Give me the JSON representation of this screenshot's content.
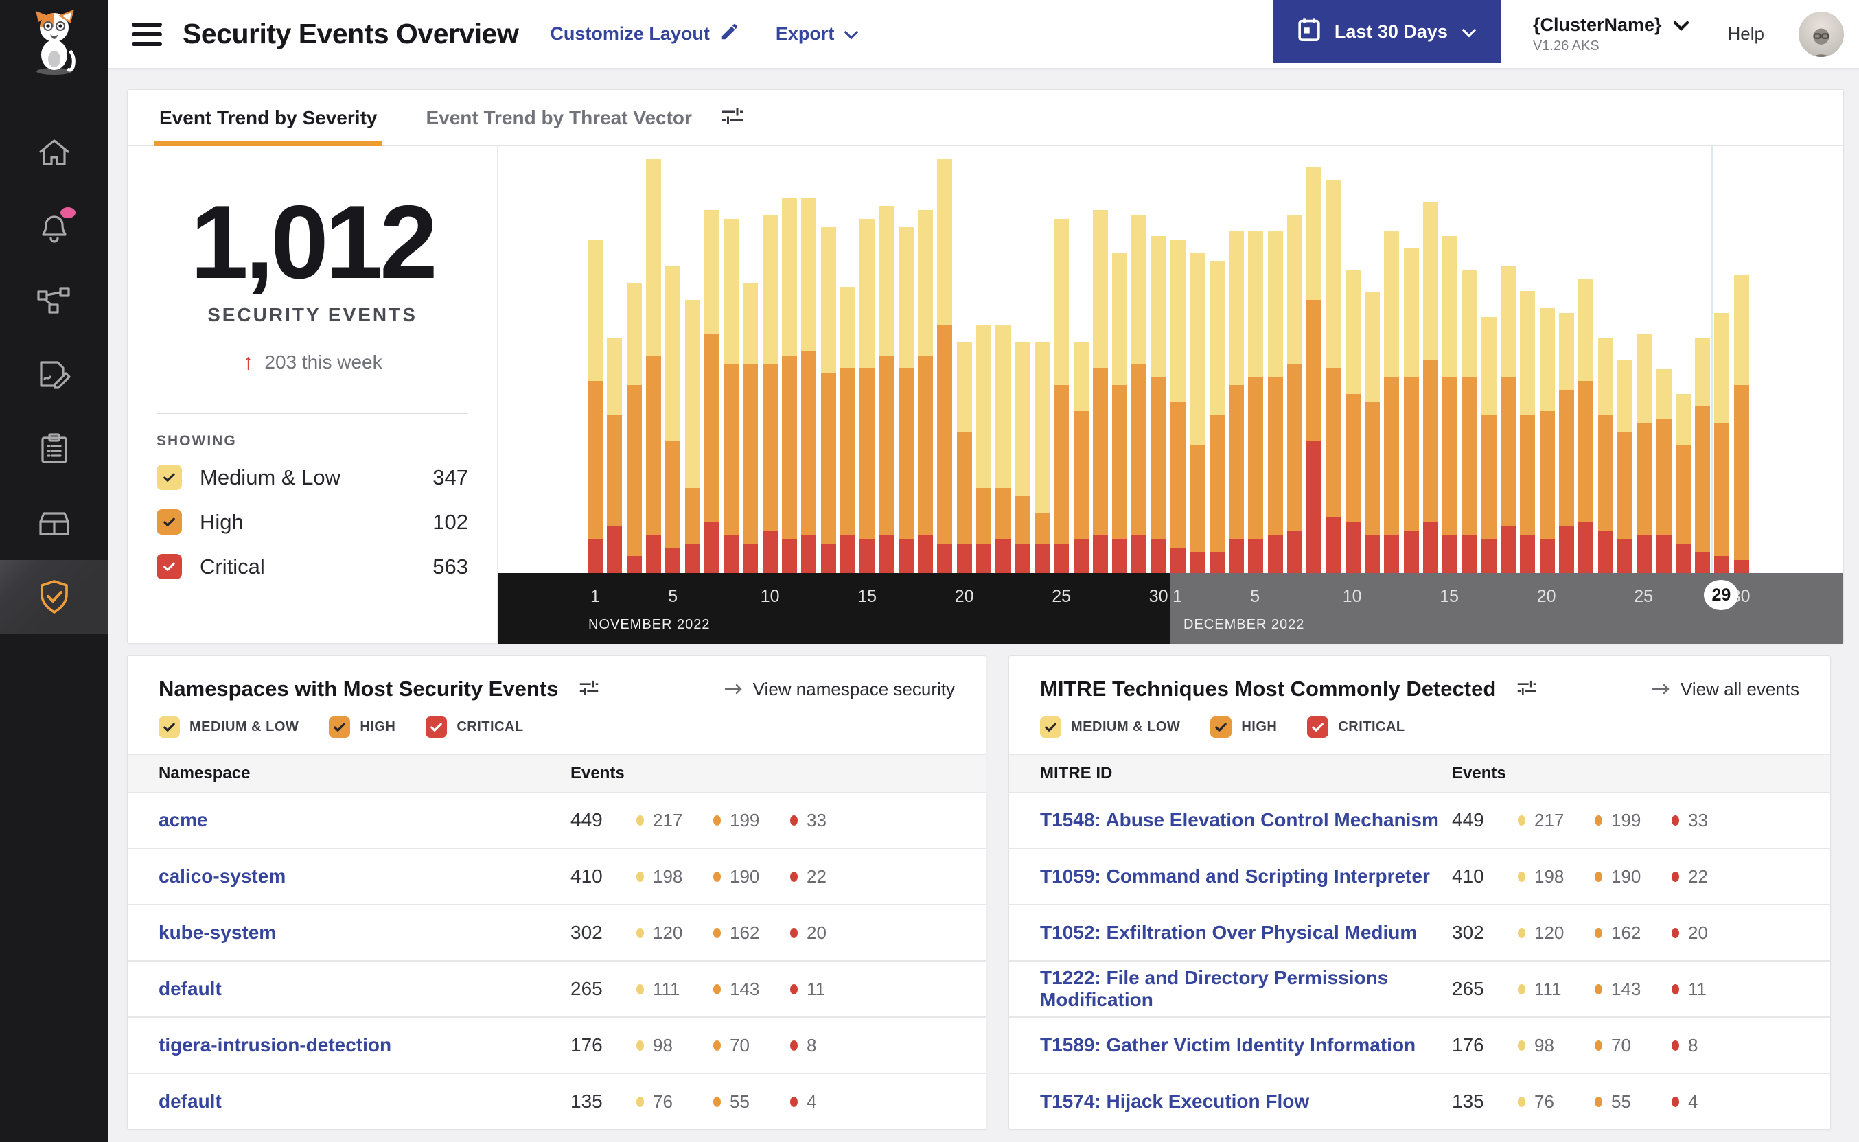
{
  "header": {
    "title": "Security Events Overview",
    "customize_layout_label": "Customize Layout",
    "export_label": "Export",
    "date_range_label": "Last 30 Days",
    "cluster_name": "{ClusterName}",
    "cluster_version": "V1.26 AKS",
    "help_label": "Help"
  },
  "sidebar": {
    "items": [
      {
        "icon": "home-icon",
        "active": false,
        "notification": false
      },
      {
        "icon": "bell-icon",
        "active": false,
        "notification": true
      },
      {
        "icon": "service-graph-icon",
        "active": false,
        "notification": false
      },
      {
        "icon": "policy-edit-icon",
        "active": false,
        "notification": false
      },
      {
        "icon": "clipboard-list-icon",
        "active": false,
        "notification": false
      },
      {
        "icon": "storage-box-icon",
        "active": false,
        "notification": false
      },
      {
        "icon": "shield-check-icon",
        "active": true,
        "notification": false
      }
    ]
  },
  "tabs": {
    "severity": "Event Trend by Severity",
    "threat_vector": "Event Trend by Threat Vector"
  },
  "summary": {
    "total": "1,012",
    "total_label": "SECURITY EVENTS",
    "delta_text": "203 this week",
    "showing_label": "SHOWING",
    "legend": [
      {
        "label": "Medium & Low",
        "count": "347",
        "color": "#f5d97e",
        "check_color": "#26262c"
      },
      {
        "label": "High",
        "count": "102",
        "color": "#e8993b",
        "check_color": "#26262c"
      },
      {
        "label": "Critical",
        "count": "563",
        "color": "#d5453c",
        "check_color": "#ffffff"
      }
    ]
  },
  "severity_filters": [
    {
      "label": "MEDIUM & LOW",
      "color": "#f5d97e",
      "check_color": "#26262c"
    },
    {
      "label": "HIGH",
      "color": "#e8993b",
      "check_color": "#26262c"
    },
    {
      "label": "CRITICAL",
      "color": "#d5453c",
      "check_color": "#ffffff"
    }
  ],
  "chart_data": {
    "type": "bar",
    "subtype": "stacked_daily_events",
    "title": "Event Trend by Severity",
    "stack_order_bottom_to_top": [
      "critical",
      "high",
      "medium_low"
    ],
    "units": "percent_of_plot_height",
    "colors": {
      "medium_low": "#f6dd88",
      "high": "#ea9b41",
      "critical": "#d4453b"
    },
    "highlighted_day": {
      "month": "DECEMBER 2022",
      "day": 29
    },
    "months": [
      {
        "label": "NOVEMBER 2022",
        "ticks": [
          1,
          5,
          10,
          15,
          20,
          25,
          30
        ],
        "bars": [
          [
            8,
            37,
            33
          ],
          [
            11,
            26,
            18
          ],
          [
            4,
            40,
            24
          ],
          [
            9,
            42,
            46
          ],
          [
            6,
            25,
            41
          ],
          [
            7,
            13,
            44
          ],
          [
            12,
            44,
            29
          ],
          [
            9,
            40,
            34
          ],
          [
            7,
            42,
            19
          ],
          [
            10,
            39,
            35
          ],
          [
            8,
            43,
            37
          ],
          [
            9,
            43,
            36
          ],
          [
            7,
            40,
            34
          ],
          [
            9,
            39,
            19
          ],
          [
            8,
            40,
            35
          ],
          [
            9,
            42,
            35
          ],
          [
            8,
            40,
            33
          ],
          [
            9,
            42,
            34
          ],
          [
            7,
            51,
            39
          ],
          [
            7,
            26,
            21
          ],
          [
            7,
            13,
            38
          ],
          [
            8,
            12,
            38
          ],
          [
            7,
            11,
            36
          ],
          [
            7,
            7,
            40
          ],
          [
            7,
            37,
            39
          ],
          [
            8,
            30,
            16
          ],
          [
            9,
            39,
            37
          ],
          [
            8,
            36,
            31
          ],
          [
            9,
            40,
            35
          ],
          [
            8,
            38,
            33
          ]
        ]
      },
      {
        "label": "DECEMBER 2022",
        "ticks": [
          1,
          5,
          10,
          15,
          20,
          25,
          30
        ],
        "bars": [
          [
            6,
            34,
            38
          ],
          [
            5,
            25,
            45
          ],
          [
            5,
            32,
            36
          ],
          [
            8,
            36,
            36
          ],
          [
            8,
            38,
            34
          ],
          [
            9,
            37,
            34
          ],
          [
            10,
            39,
            35
          ],
          [
            31,
            33,
            31
          ],
          [
            13,
            35,
            44
          ],
          [
            12,
            30,
            29
          ],
          [
            9,
            31,
            26
          ],
          [
            9,
            37,
            34
          ],
          [
            10,
            36,
            30
          ],
          [
            12,
            38,
            37
          ],
          [
            9,
            37,
            33
          ],
          [
            9,
            37,
            25
          ],
          [
            8,
            29,
            23
          ],
          [
            11,
            35,
            26
          ],
          [
            9,
            28,
            29
          ],
          [
            8,
            30,
            24
          ],
          [
            11,
            32,
            18
          ],
          [
            12,
            33,
            24
          ],
          [
            10,
            27,
            18
          ],
          [
            8,
            25,
            17
          ],
          [
            9,
            26,
            21
          ],
          [
            9,
            27,
            12
          ],
          [
            7,
            23,
            12
          ],
          [
            5,
            34,
            16
          ],
          [
            4,
            31,
            26
          ],
          [
            3,
            41,
            26
          ]
        ]
      }
    ]
  },
  "namespace_table": {
    "title": "Namespaces with Most Security Events",
    "link_label": "View namespace security",
    "col_name": "Namespace",
    "col_events": "Events",
    "rows": [
      {
        "name": "acme",
        "total": "449",
        "medium_low": "217",
        "high": "199",
        "critical": "33"
      },
      {
        "name": "calico-system",
        "total": "410",
        "medium_low": "198",
        "high": "190",
        "critical": "22"
      },
      {
        "name": "kube-system",
        "total": "302",
        "medium_low": "120",
        "high": "162",
        "critical": "20"
      },
      {
        "name": "default",
        "total": "265",
        "medium_low": "111",
        "high": "143",
        "critical": "11"
      },
      {
        "name": "tigera-intrusion-detection",
        "total": "176",
        "medium_low": "98",
        "high": "70",
        "critical": "8"
      },
      {
        "name": "default",
        "total": "135",
        "medium_low": "76",
        "high": "55",
        "critical": "4"
      }
    ]
  },
  "mitre_table": {
    "title": "MITRE Techniques Most Commonly Detected",
    "link_label": "View all events",
    "col_name": "MITRE ID",
    "col_events": "Events",
    "rows": [
      {
        "name": "T1548: Abuse Elevation Control Mechanism",
        "total": "449",
        "medium_low": "217",
        "high": "199",
        "critical": "33"
      },
      {
        "name": "T1059: Command and Scripting Interpreter",
        "total": "410",
        "medium_low": "198",
        "high": "190",
        "critical": "22"
      },
      {
        "name": "T1052: Exfiltration Over Physical Medium",
        "total": "302",
        "medium_low": "120",
        "high": "162",
        "critical": "20"
      },
      {
        "name": "T1222: File and Directory Permissions Modification",
        "total": "265",
        "medium_low": "111",
        "high": "143",
        "critical": "11"
      },
      {
        "name": "T1589: Gather Victim Identity Information",
        "total": "176",
        "medium_low": "98",
        "high": "70",
        "critical": "8"
      },
      {
        "name": "T1574: Hijack Execution Flow",
        "total": "135",
        "medium_low": "76",
        "high": "55",
        "critical": "4"
      }
    ]
  },
  "dot_colors": {
    "medium_low": "#f0d173",
    "high": "#e8993b",
    "critical": "#cf4136"
  }
}
